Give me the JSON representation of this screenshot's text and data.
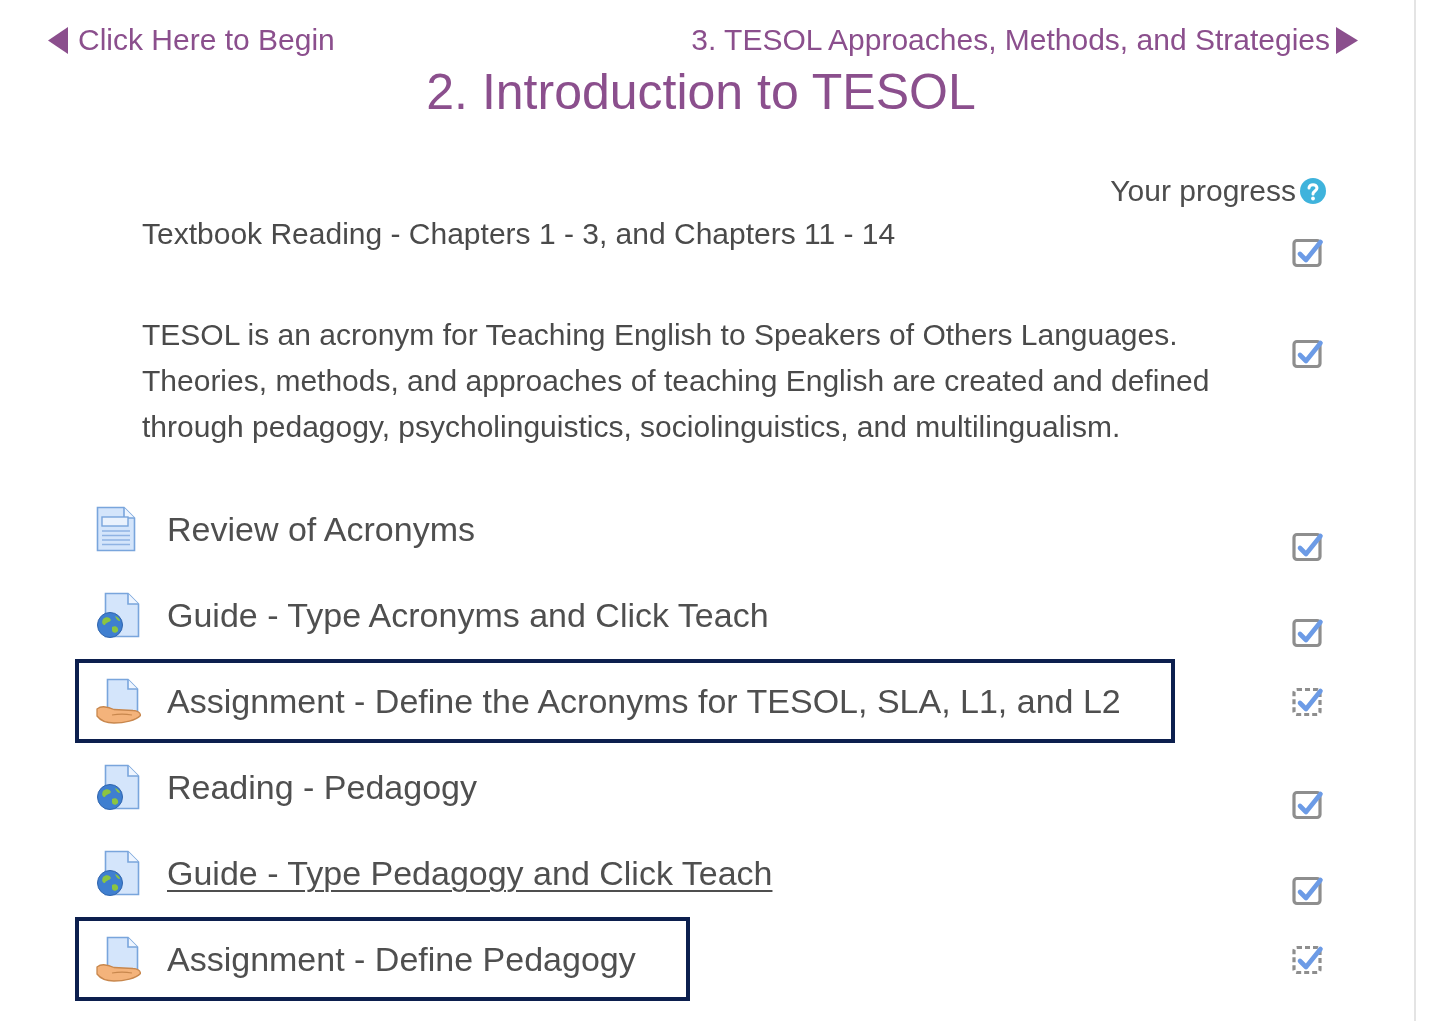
{
  "nav": {
    "previous": {
      "label": "Click Here to Begin"
    },
    "next": {
      "label": "3. TESOL Approaches, Methods, and Strategies"
    }
  },
  "section": {
    "title": "2. Introduction to TESOL",
    "progress_label": "Your progress",
    "summaries": [
      {
        "text": "Textbook Reading - Chapters 1 - 3, and Chapters 11 - 14",
        "checked": true,
        "automatic": false
      },
      {
        "text": "TESOL is an acronym for Teaching English to Speakers of Others Languages. Theories, methods, and approaches of teaching English are created and defined through pedagogy, psycholinguistics, sociolinguistics, and multilingualism.",
        "checked": true,
        "automatic": false
      }
    ],
    "activities": [
      {
        "kind": "page",
        "name": "Review of Acronyms",
        "checked": true,
        "automatic": false,
        "highlighted": false,
        "hovered": false
      },
      {
        "kind": "url",
        "name": "Guide - Type Acronyms and Click Teach",
        "checked": true,
        "automatic": false,
        "highlighted": false,
        "hovered": false
      },
      {
        "kind": "assignment",
        "name": "Assignment - Define the Acronyms for TESOL, SLA, L1, and L2",
        "checked": true,
        "automatic": true,
        "highlighted": true,
        "hovered": false
      },
      {
        "kind": "url",
        "name": "Reading - Pedagogy",
        "checked": true,
        "automatic": false,
        "highlighted": false,
        "hovered": false
      },
      {
        "kind": "url",
        "name": "Guide - Type Pedagogy and Click Teach",
        "checked": true,
        "automatic": false,
        "highlighted": false,
        "hovered": true
      },
      {
        "kind": "assignment",
        "name": "Assignment - Define Pedagogy",
        "checked": true,
        "automatic": true,
        "highlighted": true,
        "hovered": false
      }
    ]
  }
}
